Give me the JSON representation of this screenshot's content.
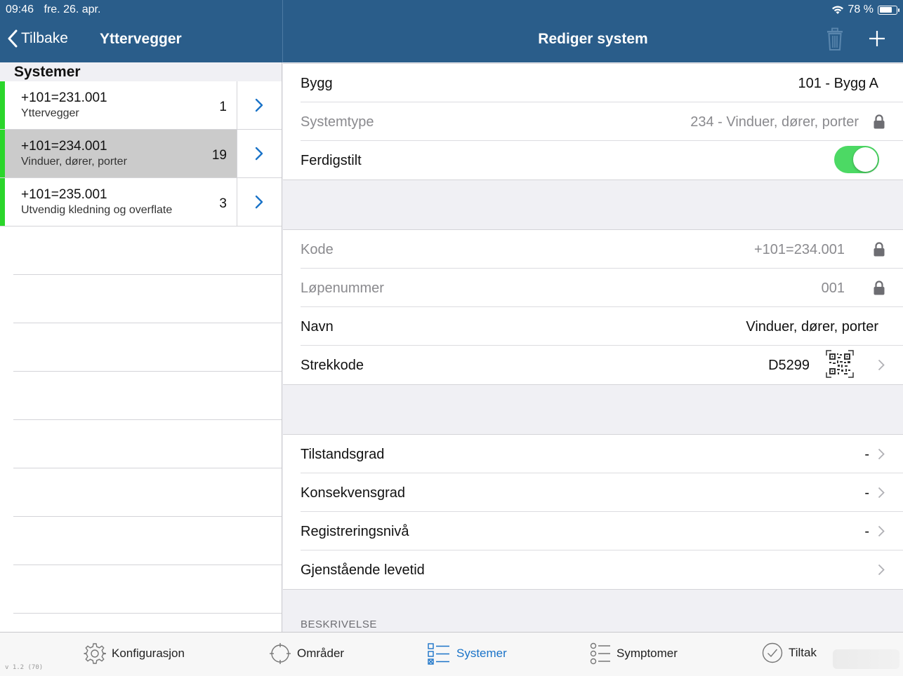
{
  "status": {
    "time": "09:46",
    "date": "fre. 26. apr.",
    "battery": "78 %",
    "battery_level": 0.78
  },
  "nav": {
    "back_label": "Tilbake",
    "left_title": "Yttervegger",
    "right_title": "Rediger system"
  },
  "list": {
    "header": "Systemer",
    "items": [
      {
        "code": "+101=231.001",
        "name": "Yttervegger",
        "count": "1"
      },
      {
        "code": "+101=234.001",
        "name": "Vinduer, dører, porter",
        "count": "19"
      },
      {
        "code": "+101=235.001",
        "name": "Utvendig kledning og overflate",
        "count": "3"
      }
    ]
  },
  "form": {
    "bygg": {
      "label": "Bygg",
      "value": "101 - Bygg A"
    },
    "systemtype": {
      "label": "Systemtype",
      "value": "234 - Vinduer, dører, porter"
    },
    "ferdigstilt": {
      "label": "Ferdigstilt",
      "on": true
    },
    "kode": {
      "label": "Kode",
      "value": "+101=234.001"
    },
    "lopenummer": {
      "label": "Løpenummer",
      "value": "001"
    },
    "navn": {
      "label": "Navn",
      "value": "Vinduer, dører, porter"
    },
    "strekkode": {
      "label": "Strekkode",
      "value": "D5299"
    },
    "tilstandsgrad": {
      "label": "Tilstandsgrad",
      "value": "-"
    },
    "konsekvensgrad": {
      "label": "Konsekvensgrad",
      "value": "-"
    },
    "registreringsniva": {
      "label": "Registreringsnivå",
      "value": "-"
    },
    "gjenstaende": {
      "label": "Gjenstående levetid"
    },
    "beskrivelse_header": "BESKRIVELSE"
  },
  "tabs": {
    "konfigurasjon": "Konfigurasjon",
    "omrader": "Områder",
    "systemer": "Systemer",
    "symptomer": "Symptomer",
    "tiltak": "Tiltak"
  },
  "version": "v 1.2 (70)",
  "colors": {
    "header": "#2a5d8a",
    "accent": "#1a73c8",
    "status_green": "#2bd62b",
    "toggle_on": "#4cd964"
  }
}
